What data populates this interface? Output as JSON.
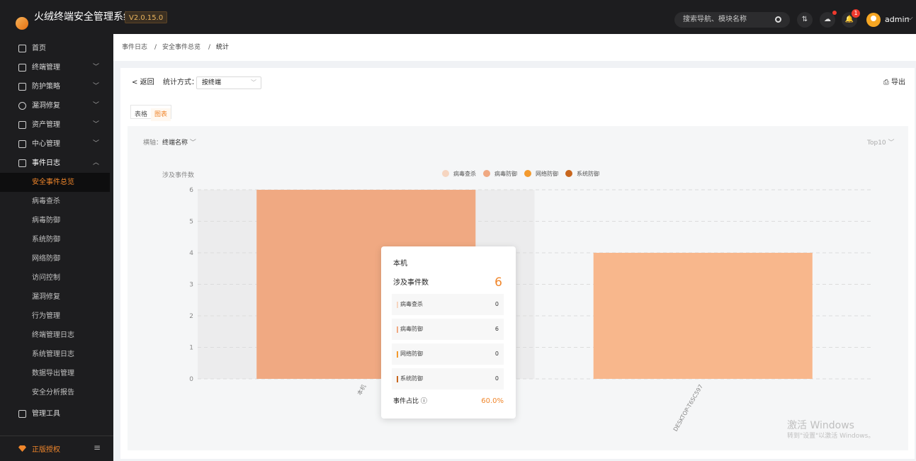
{
  "app": {
    "title": "火绒终端安全管理系统",
    "version": "V2.0.15.0"
  },
  "header": {
    "search_placeholder": "搜索导航、模块名称",
    "notification_count": "1",
    "user_name": "admin",
    "icons": [
      "search-icon",
      "transfer-icon",
      "cloud-icon",
      "bell-icon",
      "user-avatar-icon"
    ]
  },
  "sidebar": {
    "items": [
      {
        "label": "首页",
        "icon": "home-icon"
      },
      {
        "label": "终端管理",
        "icon": "monitor-icon"
      },
      {
        "label": "防护策略",
        "icon": "strategy-icon"
      },
      {
        "label": "漏洞修复",
        "icon": "target-icon"
      },
      {
        "label": "资产管理",
        "icon": "box-icon"
      },
      {
        "label": "中心管理",
        "icon": "server-icon"
      },
      {
        "label": "事件日志",
        "icon": "calendar-icon"
      }
    ],
    "sub_items": [
      "安全事件总览",
      "病毒查杀",
      "病毒防御",
      "系统防御",
      "网络防御",
      "访问控制",
      "漏洞修复",
      "行为管理",
      "终端管理日志",
      "系统管理日志",
      "数据导出管理",
      "安全分析报告"
    ],
    "tools_label": "管理工具",
    "license_label": "正版授权"
  },
  "breadcrumb": {
    "items": [
      "事件日志",
      "安全事件总览",
      "统计"
    ],
    "separator": "/"
  },
  "toolbar": {
    "back_label": "返回",
    "mode_label": "统计方式：",
    "mode_value": "按终端",
    "export_label": "导出"
  },
  "tabs": {
    "items": [
      "表格",
      "图表"
    ],
    "active": "图表"
  },
  "chart_controls": {
    "axis_label": "横轴：",
    "axis_value": "终端名称",
    "top_value": "Top10"
  },
  "chart_data": {
    "type": "bar",
    "ylabel": "涉及事件数",
    "categories": [
      "本机",
      "DESKTOP-T6SC597"
    ],
    "series": [
      {
        "name": "病毒查杀",
        "values": [
          0,
          0
        ],
        "color": "#f6d5c0"
      },
      {
        "name": "病毒防御",
        "values": [
          6,
          4
        ],
        "color": "#f0a982"
      },
      {
        "name": "网络防御",
        "values": [
          0,
          0
        ],
        "color": "#f39a2e"
      },
      {
        "name": "系统防御",
        "values": [
          0,
          0
        ],
        "color": "#c8661d"
      }
    ],
    "yticks": [
      0,
      1,
      2,
      3,
      4,
      5,
      6
    ],
    "ylim": [
      0,
      6
    ],
    "legend": "top-center",
    "grid": true,
    "highlighted_category": "本机"
  },
  "tooltip": {
    "title": "本机",
    "count_label": "涉及事件数",
    "count_value": "6",
    "rows": [
      {
        "name": "病毒查杀",
        "value": "0",
        "color": "#f6d5c0"
      },
      {
        "name": "病毒防御",
        "value": "6",
        "color": "#f0a982"
      },
      {
        "name": "网络防御",
        "value": "0",
        "color": "#f39a2e"
      },
      {
        "name": "系统防御",
        "value": "0",
        "color": "#c8661d"
      }
    ],
    "ratio_label": "事件占比",
    "ratio_value": "60.0%"
  },
  "watermark": {
    "title": "激活 Windows",
    "subtitle": "转到\"设置\"以激活 Windows。"
  }
}
